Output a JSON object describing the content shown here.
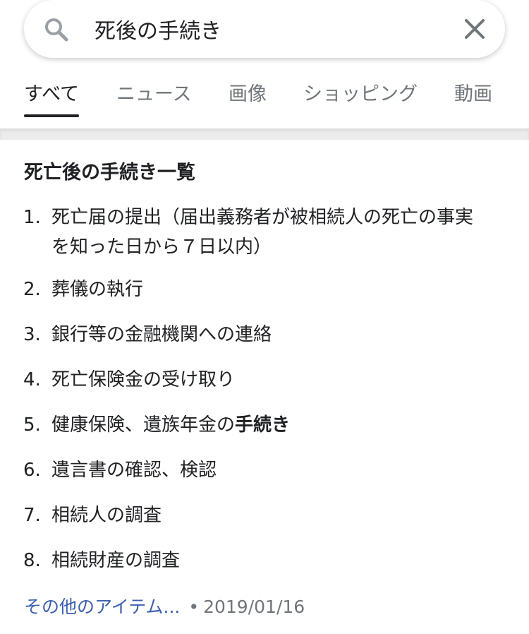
{
  "search": {
    "query": "死後の手続き"
  },
  "tabs": [
    {
      "label": "すべて",
      "active": true
    },
    {
      "label": "ニュース",
      "active": false
    },
    {
      "label": "画像",
      "active": false
    },
    {
      "label": "ショッピング",
      "active": false
    },
    {
      "label": "動画",
      "active": false
    }
  ],
  "snippet": {
    "title": "死亡後の手続き一覧",
    "items": [
      {
        "num": "1.",
        "line1": "死亡届の提出（届出義務者が被相続人の死亡の事実",
        "line2": "を知った日から７日以内）"
      },
      {
        "num": "2.",
        "text": "葬儀の執行"
      },
      {
        "num": "3.",
        "text": "銀行等の金融機関への連絡"
      },
      {
        "num": "4.",
        "text": "死亡保険金の受け取り"
      },
      {
        "num": "5.",
        "text_plain": "健康保険、遺族年金の",
        "text_bold": "手続き"
      },
      {
        "num": "6.",
        "text": "遺言書の確認、検認"
      },
      {
        "num": "7.",
        "text": "相続人の調査"
      },
      {
        "num": "8.",
        "text": "相続財産の調査"
      }
    ],
    "more_link": "その他のアイテム...",
    "separator": "•",
    "date": "2019/01/16"
  },
  "colors": {
    "link": "#3b5fae",
    "muted": "#70757a",
    "text": "#202124"
  }
}
